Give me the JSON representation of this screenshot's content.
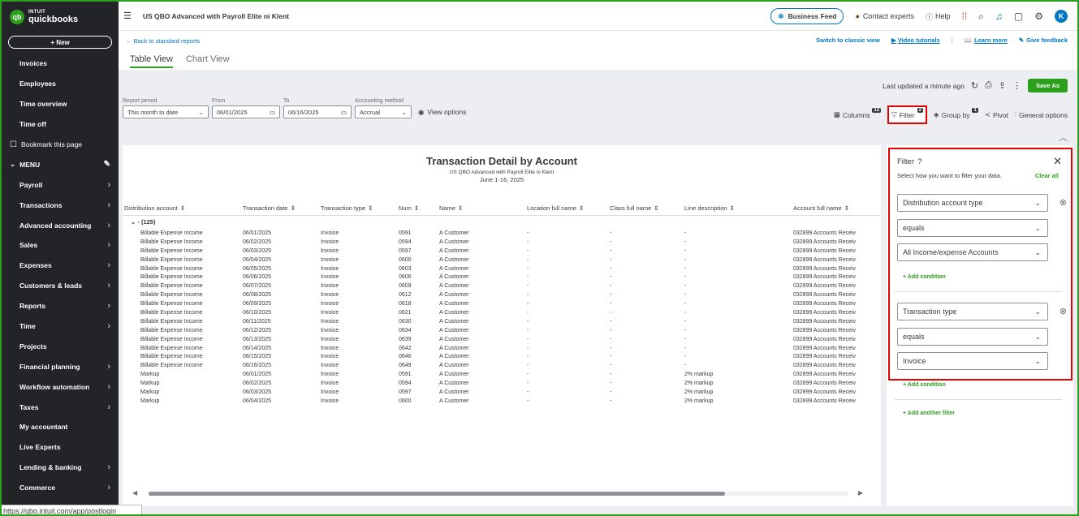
{
  "app": {
    "brand_top": "INTUIT",
    "brand_name": "quickbooks",
    "new_button": "+ New",
    "status_url": "https://qbo.intuit.com/app/postlogin"
  },
  "sidebar": {
    "items_top": [
      {
        "label": "Invoices",
        "chevron": false
      },
      {
        "label": "Employees",
        "chevron": false
      },
      {
        "label": "Time overview",
        "chevron": false
      },
      {
        "label": "Time off",
        "chevron": false
      }
    ],
    "bookmark": "Bookmark this page",
    "menu_label": "MENU",
    "items_menu": [
      {
        "label": "Payroll",
        "chevron": true
      },
      {
        "label": "Transactions",
        "chevron": true
      },
      {
        "label": "Advanced accounting",
        "chevron": true
      },
      {
        "label": "Sales",
        "chevron": true
      },
      {
        "label": "Expenses",
        "chevron": true
      },
      {
        "label": "Customers & leads",
        "chevron": true
      },
      {
        "label": "Reports",
        "chevron": true
      },
      {
        "label": "Time",
        "chevron": true
      },
      {
        "label": "Projects",
        "chevron": false
      },
      {
        "label": "Financial planning",
        "chevron": true
      },
      {
        "label": "Workflow automation",
        "chevron": true
      },
      {
        "label": "Taxes",
        "chevron": true
      },
      {
        "label": "My accountant",
        "chevron": false
      },
      {
        "label": "Live Experts",
        "chevron": false
      },
      {
        "label": "Lending & banking",
        "chevron": true
      },
      {
        "label": "Commerce",
        "chevron": true
      }
    ]
  },
  "topbar": {
    "company": "US QBO Advanced with Payroll Elite ni Klent",
    "business_feed": "Business Feed",
    "contact_experts": "Contact experts",
    "help": "Help",
    "avatar_letter": "K"
  },
  "links": {
    "back": "← Back to standard reports",
    "classic": "Switch to classic view",
    "video": "Video tutorials",
    "learn": "Learn more",
    "feedback": "Give feedback"
  },
  "tabs": [
    {
      "label": "Table View",
      "active": true
    },
    {
      "label": "Chart View",
      "active": false
    }
  ],
  "toolbar": {
    "last_updated": "Last updated a minute ago",
    "save_as": "Save As",
    "report_period_label": "Report period",
    "report_period": "This month to date",
    "from_label": "From",
    "from": "06/01/2025",
    "to_label": "To",
    "to": "06/16/2025",
    "method_label": "Accounting method",
    "method": "Accrual",
    "view_options": "View options",
    "columns": "Columns",
    "columns_count": "12",
    "filter": "Filter",
    "filter_count": "2",
    "group_by": "Group by",
    "group_count": "1",
    "pivot": "Pivot",
    "general_options": "General options"
  },
  "report": {
    "title": "Transaction Detail by Account",
    "company": "US QBO Advanced with Payroll Elite ni Klent",
    "period": "June 1-16, 2025",
    "columns": [
      "Distribution account",
      "Transaction date",
      "Transaction type",
      "Num",
      "Name",
      "Location full name",
      "Class full name",
      "Line description",
      "Account full name"
    ],
    "group_label": "- (125)",
    "rows": [
      [
        "Billable Expense Income",
        "06/01/2025",
        "Invoice",
        "0591",
        "A Customer",
        "-",
        "-",
        "-",
        "032899 Accounts Receiv"
      ],
      [
        "Billable Expense Income",
        "06/02/2025",
        "Invoice",
        "0594",
        "A Customer",
        "-",
        "-",
        "-",
        "032899 Accounts Receiv"
      ],
      [
        "Billable Expense Income",
        "06/03/2025",
        "Invoice",
        "0597",
        "A Customer",
        "-",
        "-",
        "-",
        "032899 Accounts Receiv"
      ],
      [
        "Billable Expense Income",
        "06/04/2025",
        "Invoice",
        "0600",
        "A Customer",
        "-",
        "-",
        "-",
        "032899 Accounts Receiv"
      ],
      [
        "Billable Expense Income",
        "06/05/2025",
        "Invoice",
        "0603",
        "A Customer",
        "-",
        "-",
        "-",
        "032899 Accounts Receiv"
      ],
      [
        "Billable Expense Income",
        "06/06/2025",
        "Invoice",
        "0606",
        "A Customer",
        "-",
        "-",
        "-",
        "032899 Accounts Receiv"
      ],
      [
        "Billable Expense Income",
        "06/07/2025",
        "Invoice",
        "0609",
        "A Customer",
        "-",
        "-",
        "-",
        "032899 Accounts Receiv"
      ],
      [
        "Billable Expense Income",
        "06/08/2025",
        "Invoice",
        "0612",
        "A Customer",
        "-",
        "-",
        "-",
        "032899 Accounts Receiv"
      ],
      [
        "Billable Expense Income",
        "06/09/2025",
        "Invoice",
        "0618",
        "A Customer",
        "-",
        "-",
        "-",
        "032899 Accounts Receiv"
      ],
      [
        "Billable Expense Income",
        "06/10/2025",
        "Invoice",
        "0621",
        "A Customer",
        "-",
        "-",
        "-",
        "032899 Accounts Receiv"
      ],
      [
        "Billable Expense Income",
        "06/11/2025",
        "Invoice",
        "0630",
        "A Customer",
        "-",
        "-",
        "-",
        "032899 Accounts Receiv"
      ],
      [
        "Billable Expense Income",
        "06/12/2025",
        "Invoice",
        "0634",
        "A Customer",
        "-",
        "-",
        "-",
        "032899 Accounts Receiv"
      ],
      [
        "Billable Expense Income",
        "06/13/2025",
        "Invoice",
        "0639",
        "A Customer",
        "-",
        "-",
        "-",
        "032899 Accounts Receiv"
      ],
      [
        "Billable Expense Income",
        "06/14/2025",
        "Invoice",
        "0642",
        "A Customer",
        "-",
        "-",
        "-",
        "032899 Accounts Receiv"
      ],
      [
        "Billable Expense Income",
        "06/15/2025",
        "Invoice",
        "0646",
        "A Customer",
        "-",
        "-",
        "-",
        "032899 Accounts Receiv"
      ],
      [
        "Billable Expense Income",
        "06/16/2025",
        "Invoice",
        "0649",
        "A Customer",
        "-",
        "-",
        "-",
        "032899 Accounts Receiv"
      ],
      [
        "Markup",
        "06/01/2025",
        "Invoice",
        "0591",
        "A Customer",
        "-",
        "-",
        "2% markup",
        "032899 Accounts Receiv"
      ],
      [
        "Markup",
        "06/02/2025",
        "Invoice",
        "0594",
        "A Customer",
        "-",
        "-",
        "2% markup",
        "032899 Accounts Receiv"
      ],
      [
        "Markup",
        "06/03/2025",
        "Invoice",
        "0597",
        "A Customer",
        "-",
        "-",
        "2% markup",
        "032899 Accounts Receiv"
      ],
      [
        "Markup",
        "06/04/2025",
        "Invoice",
        "0600",
        "A Customer",
        "-",
        "-",
        "2% markup",
        "032899 Accounts Receiv"
      ]
    ]
  },
  "filter_panel": {
    "title": "Filter",
    "hint": "Select how you want to filter your data.",
    "clear_all": "Clear all",
    "filter1_field": "Distribution account type",
    "filter1_op": "equals",
    "filter1_value": "All Income/expense Accounts",
    "filter2_field": "Transaction type",
    "filter2_op": "equals",
    "filter2_value": "Invoice",
    "add_condition": "+ Add condition",
    "add_filter": "+ Add another filter"
  },
  "colors": {
    "brand_green": "#2ca01c",
    "sidebar_bg": "#232428",
    "link_blue": "#0077c5",
    "highlight_red": "#e60000"
  }
}
